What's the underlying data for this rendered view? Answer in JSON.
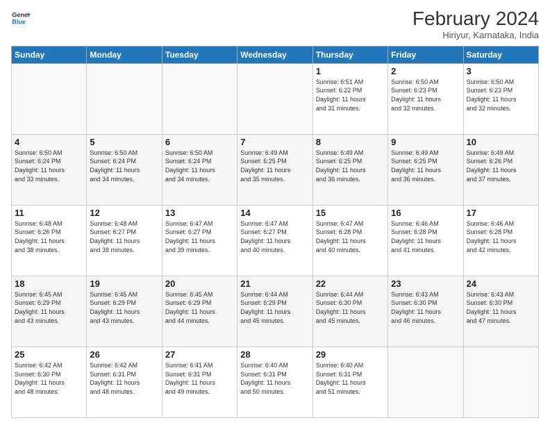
{
  "header": {
    "title": "February 2024",
    "subtitle": "Hiriyur, Karnataka, India",
    "logo_line1": "General",
    "logo_line2": "Blue"
  },
  "weekdays": [
    "Sunday",
    "Monday",
    "Tuesday",
    "Wednesday",
    "Thursday",
    "Friday",
    "Saturday"
  ],
  "weeks": [
    [
      {
        "day": "",
        "info": ""
      },
      {
        "day": "",
        "info": ""
      },
      {
        "day": "",
        "info": ""
      },
      {
        "day": "",
        "info": ""
      },
      {
        "day": "1",
        "info": "Sunrise: 6:51 AM\nSunset: 6:22 PM\nDaylight: 11 hours\nand 31 minutes."
      },
      {
        "day": "2",
        "info": "Sunrise: 6:50 AM\nSunset: 6:23 PM\nDaylight: 11 hours\nand 32 minutes."
      },
      {
        "day": "3",
        "info": "Sunrise: 6:50 AM\nSunset: 6:23 PM\nDaylight: 11 hours\nand 32 minutes."
      }
    ],
    [
      {
        "day": "4",
        "info": "Sunrise: 6:50 AM\nSunset: 6:24 PM\nDaylight: 11 hours\nand 33 minutes."
      },
      {
        "day": "5",
        "info": "Sunrise: 6:50 AM\nSunset: 6:24 PM\nDaylight: 11 hours\nand 34 minutes."
      },
      {
        "day": "6",
        "info": "Sunrise: 6:50 AM\nSunset: 6:24 PM\nDaylight: 11 hours\nand 34 minutes."
      },
      {
        "day": "7",
        "info": "Sunrise: 6:49 AM\nSunset: 6:25 PM\nDaylight: 11 hours\nand 35 minutes."
      },
      {
        "day": "8",
        "info": "Sunrise: 6:49 AM\nSunset: 6:25 PM\nDaylight: 11 hours\nand 36 minutes."
      },
      {
        "day": "9",
        "info": "Sunrise: 6:49 AM\nSunset: 6:25 PM\nDaylight: 11 hours\nand 36 minutes."
      },
      {
        "day": "10",
        "info": "Sunrise: 6:49 AM\nSunset: 6:26 PM\nDaylight: 11 hours\nand 37 minutes."
      }
    ],
    [
      {
        "day": "11",
        "info": "Sunrise: 6:48 AM\nSunset: 6:26 PM\nDaylight: 11 hours\nand 38 minutes."
      },
      {
        "day": "12",
        "info": "Sunrise: 6:48 AM\nSunset: 6:27 PM\nDaylight: 11 hours\nand 38 minutes."
      },
      {
        "day": "13",
        "info": "Sunrise: 6:47 AM\nSunset: 6:27 PM\nDaylight: 11 hours\nand 39 minutes."
      },
      {
        "day": "14",
        "info": "Sunrise: 6:47 AM\nSunset: 6:27 PM\nDaylight: 11 hours\nand 40 minutes."
      },
      {
        "day": "15",
        "info": "Sunrise: 6:47 AM\nSunset: 6:28 PM\nDaylight: 11 hours\nand 40 minutes."
      },
      {
        "day": "16",
        "info": "Sunrise: 6:46 AM\nSunset: 6:28 PM\nDaylight: 11 hours\nand 41 minutes."
      },
      {
        "day": "17",
        "info": "Sunrise: 6:46 AM\nSunset: 6:28 PM\nDaylight: 11 hours\nand 42 minutes."
      }
    ],
    [
      {
        "day": "18",
        "info": "Sunrise: 6:45 AM\nSunset: 6:29 PM\nDaylight: 11 hours\nand 43 minutes."
      },
      {
        "day": "19",
        "info": "Sunrise: 6:45 AM\nSunset: 6:29 PM\nDaylight: 11 hours\nand 43 minutes."
      },
      {
        "day": "20",
        "info": "Sunrise: 6:45 AM\nSunset: 6:29 PM\nDaylight: 11 hours\nand 44 minutes."
      },
      {
        "day": "21",
        "info": "Sunrise: 6:44 AM\nSunset: 6:29 PM\nDaylight: 11 hours\nand 45 minutes."
      },
      {
        "day": "22",
        "info": "Sunrise: 6:44 AM\nSunset: 6:30 PM\nDaylight: 11 hours\nand 45 minutes."
      },
      {
        "day": "23",
        "info": "Sunrise: 6:43 AM\nSunset: 6:30 PM\nDaylight: 11 hours\nand 46 minutes."
      },
      {
        "day": "24",
        "info": "Sunrise: 6:43 AM\nSunset: 6:30 PM\nDaylight: 11 hours\nand 47 minutes."
      }
    ],
    [
      {
        "day": "25",
        "info": "Sunrise: 6:42 AM\nSunset: 6:30 PM\nDaylight: 11 hours\nand 48 minutes."
      },
      {
        "day": "26",
        "info": "Sunrise: 6:42 AM\nSunset: 6:31 PM\nDaylight: 11 hours\nand 48 minutes."
      },
      {
        "day": "27",
        "info": "Sunrise: 6:41 AM\nSunset: 6:31 PM\nDaylight: 11 hours\nand 49 minutes."
      },
      {
        "day": "28",
        "info": "Sunrise: 6:40 AM\nSunset: 6:31 PM\nDaylight: 11 hours\nand 50 minutes."
      },
      {
        "day": "29",
        "info": "Sunrise: 6:40 AM\nSunset: 6:31 PM\nDaylight: 11 hours\nand 51 minutes."
      },
      {
        "day": "",
        "info": ""
      },
      {
        "day": "",
        "info": ""
      }
    ]
  ]
}
